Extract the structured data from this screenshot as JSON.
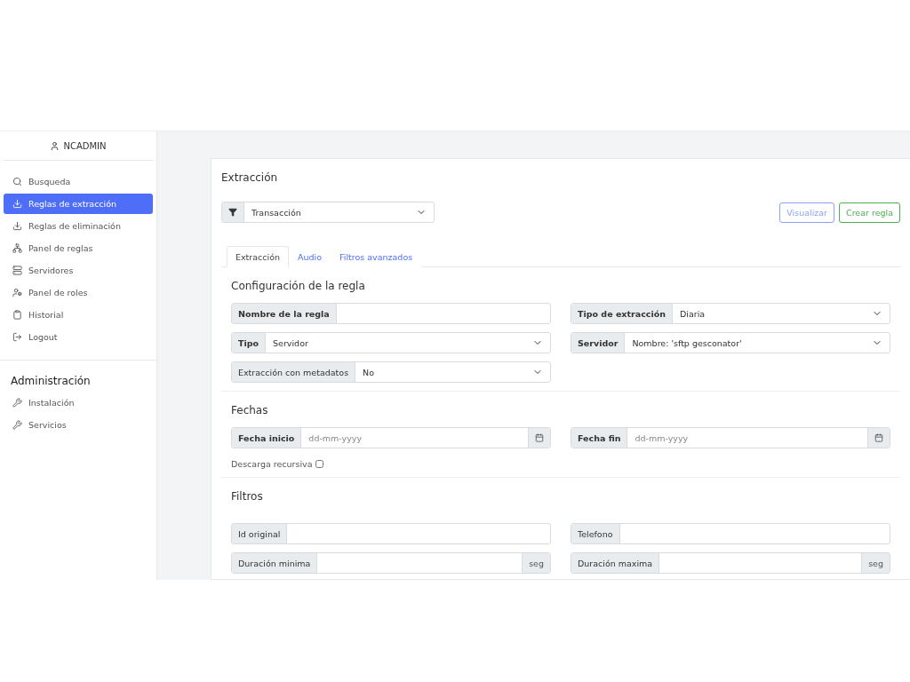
{
  "sidebar": {
    "user": "NCADMIN",
    "items": [
      {
        "label": "Busqueda",
        "selected": false
      },
      {
        "label": "Reglas de extracción",
        "selected": true
      },
      {
        "label": "Reglas de eliminación",
        "selected": false
      },
      {
        "label": "Panel de reglas",
        "selected": false
      },
      {
        "label": "Servidores",
        "selected": false
      },
      {
        "label": "Panel de roles",
        "selected": false
      },
      {
        "label": "Historial",
        "selected": false
      },
      {
        "label": "Logout",
        "selected": false
      }
    ],
    "admin_title": "Administración",
    "admin_items": [
      {
        "label": "Instalación",
        "selected": false
      },
      {
        "label": "Servicios",
        "selected": false
      }
    ]
  },
  "main": {
    "title": "Extracción",
    "filter": {
      "value": "Transacción"
    },
    "buttons": [
      {
        "label": "Visualizar",
        "kind": "primary"
      },
      {
        "label": "Crear regla",
        "kind": "success"
      }
    ],
    "tabs": [
      {
        "label": "Extracción",
        "selected": true
      },
      {
        "label": "Audio",
        "selected": false
      },
      {
        "label": "Filtros avanzados",
        "selected": false
      }
    ],
    "sections": [
      {
        "title": "Configuración de la regla",
        "rows": [
          [
            {
              "label": "Nombre de la regla",
              "kind": "text",
              "bold": true
            },
            {
              "label": "Tipo de extracción",
              "kind": "select",
              "value": "Diaria",
              "bold": true
            }
          ],
          [
            {
              "label": "Tipo",
              "kind": "select",
              "value": "Servidor",
              "bold": true
            },
            {
              "label": "Servidor",
              "kind": "select",
              "value": "Nombre: 'sftp gesconator'",
              "bold": true
            }
          ],
          [
            {
              "label": "Extracción con metadatos",
              "kind": "select",
              "value": "No",
              "bold": false
            }
          ]
        ]
      },
      {
        "title": "Fechas",
        "rows": [
          [
            {
              "label": "Fecha inicio",
              "kind": "date",
              "placeholder": "dd-mm-yyyy",
              "bold": true
            },
            {
              "label": "Fecha fin",
              "kind": "date",
              "placeholder": "dd-mm-yyyy",
              "bold": true
            }
          ]
        ],
        "checkbox": {
          "label": "Descarga recursiva",
          "checked": false
        }
      },
      {
        "title": "Filtros",
        "rows": [
          [
            {
              "label": "Id original",
              "kind": "text",
              "bold": false
            },
            {
              "label": "Telefono",
              "kind": "text",
              "bold": false
            }
          ],
          [
            {
              "label": "Duración minima",
              "kind": "unit",
              "unit": "seg",
              "bold": false
            },
            {
              "label": "Duración maxima",
              "kind": "unit",
              "unit": "seg",
              "bold": false
            }
          ]
        ]
      }
    ]
  }
}
